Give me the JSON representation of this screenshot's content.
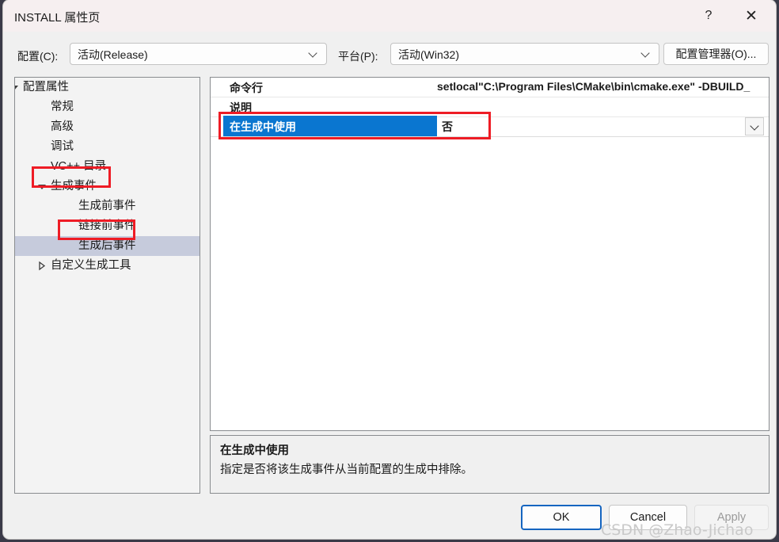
{
  "window": {
    "title": "INSTALL 属性页",
    "help_icon": "?",
    "close_icon": "✕"
  },
  "config_bar": {
    "config_label": "配置(C):",
    "config_value": "活动(Release)",
    "platform_label": "平台(P):",
    "platform_value": "活动(Win32)",
    "config_manager_label": "配置管理器(O)..."
  },
  "tree": {
    "items": [
      {
        "label": "配置属性",
        "indent": 10,
        "twisty": "open",
        "selected": false
      },
      {
        "label": "常规",
        "indent": 45,
        "twisty": "none",
        "selected": false
      },
      {
        "label": "高级",
        "indent": 45,
        "twisty": "none",
        "selected": false
      },
      {
        "label": "调试",
        "indent": 45,
        "twisty": "none",
        "selected": false
      },
      {
        "label": "VC++ 目录",
        "indent": 45,
        "twisty": "none",
        "selected": false
      },
      {
        "label": "生成事件",
        "indent": 45,
        "twisty": "open",
        "selected": false
      },
      {
        "label": "生成前事件",
        "indent": 80,
        "twisty": "none",
        "selected": false
      },
      {
        "label": "链接前事件",
        "indent": 80,
        "twisty": "none",
        "selected": false
      },
      {
        "label": "生成后事件",
        "indent": 80,
        "twisty": "none",
        "selected": true
      },
      {
        "label": "自定义生成工具",
        "indent": 45,
        "twisty": "closed",
        "selected": false
      }
    ]
  },
  "grid": {
    "rows": [
      {
        "name": "命令行",
        "value": "setlocal\"C:\\Program Files\\CMake\\bin\\cmake.exe\" -DBUILD_"
      },
      {
        "name": "说明",
        "value": ""
      }
    ],
    "selected_row": {
      "name": "在生成中使用",
      "value": "否",
      "dropdown_icon": "chevron-down"
    }
  },
  "description": {
    "title": "在生成中使用",
    "text": "指定是否将该生成事件从当前配置的生成中排除。"
  },
  "footer": {
    "ok_label": "OK",
    "cancel_label": "Cancel",
    "apply_label": "Apply"
  },
  "watermark": {
    "text": "CSDN @Zhao-Jichao"
  },
  "colors": {
    "titlebar": "#f6eff0",
    "dialog_bg": "#f0f0f0",
    "selection_blue": "#0a76d0",
    "tree_selection": "#c6cbdc",
    "annotation_red": "#ee1c25",
    "focus_border": "#1565c0"
  }
}
